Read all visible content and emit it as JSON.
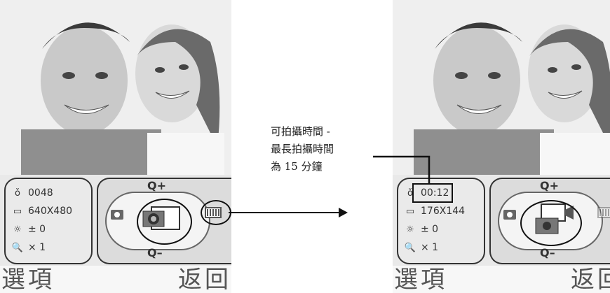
{
  "left_screen": {
    "status": {
      "shots_remaining": "0048",
      "resolution": "640X480",
      "brightness": "± 0",
      "zoom": "× 1"
    },
    "mode": {
      "zoom_in_label": "Q+",
      "zoom_out_label": "Q–",
      "active_mode": "camera-icon",
      "highlighted": "film-icon"
    },
    "softkeys": {
      "left": "選項",
      "right": "返回"
    }
  },
  "right_screen": {
    "status": {
      "remaining_time": "00:12",
      "resolution": "176X144",
      "brightness": "± 0",
      "zoom": "× 1"
    },
    "mode": {
      "zoom_in_label": "Q+",
      "zoom_out_label": "Q–",
      "active_mode": "video-camera-icon"
    },
    "softkeys": {
      "left": "選項",
      "right": "返回"
    }
  },
  "annotation": {
    "line1": "可拍攝時間 -",
    "line2": "最長拍攝時間",
    "line3": "為 15 分鐘"
  }
}
